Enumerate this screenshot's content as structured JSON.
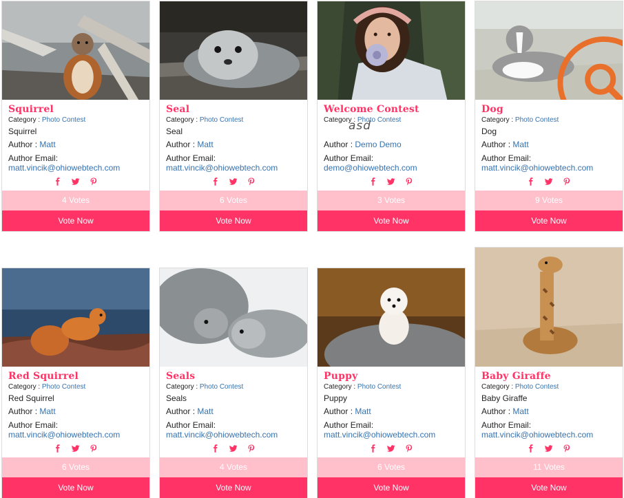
{
  "labels": {
    "category_prefix": "Category :",
    "author_prefix": "Author :",
    "email_prefix": "Author Email:",
    "vote_button": "Vote Now"
  },
  "icons": [
    "facebook-icon",
    "twitter-icon",
    "pinterest-icon",
    "zoom-icon"
  ],
  "colors": {
    "accent": "#ff3366",
    "votes_bar": "#ffc0cc",
    "link": "#3572b0"
  },
  "cards": [
    {
      "title": "Squirrel",
      "category": "Photo Contest",
      "description": "Squirrel",
      "author": "Matt",
      "email": "matt.vincik@ohiowebtech.com",
      "votes": "4 Votes"
    },
    {
      "title": "Seal",
      "category": "Photo Contest",
      "description": "Seal",
      "author": "Matt",
      "email": "matt.vincik@ohiowebtech.com",
      "votes": "6 Votes"
    },
    {
      "title": "Welcome Contest",
      "category": "Photo Contest",
      "description": "asd",
      "author": "Demo Demo",
      "email": "demo@ohiowebtech.com",
      "votes": "3 Votes"
    },
    {
      "title": "Dog",
      "category": "Photo Contest",
      "description": "Dog",
      "author": "Matt",
      "email": "matt.vincik@ohiowebtech.com",
      "votes": "9 Votes"
    },
    {
      "title": "Red Squirrel",
      "category": "Photo Contest",
      "description": "Red Squirrel",
      "author": "Matt",
      "email": "matt.vincik@ohiowebtech.com",
      "votes": "6 Votes"
    },
    {
      "title": "Seals",
      "category": "Photo Contest",
      "description": "Seals",
      "author": "Matt",
      "email": "matt.vincik@ohiowebtech.com",
      "votes": "4 Votes"
    },
    {
      "title": "Puppy",
      "category": "Photo Contest",
      "description": "Puppy",
      "author": "Matt",
      "email": "matt.vincik@ohiowebtech.com",
      "votes": "6 Votes"
    },
    {
      "title": "Baby Giraffe",
      "category": "Photo Contest",
      "description": "Baby Giraffe",
      "author": "Matt",
      "email": "matt.vincik@ohiowebtech.com",
      "votes": "11 Votes"
    }
  ]
}
